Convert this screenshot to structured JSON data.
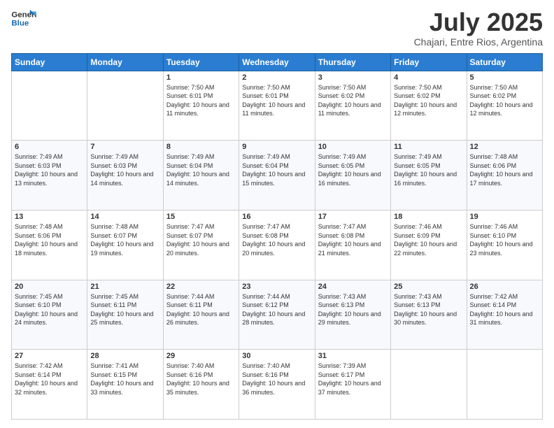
{
  "header": {
    "logo_line1": "General",
    "logo_line2": "Blue",
    "title": "July 2025",
    "subtitle": "Chajari, Entre Rios, Argentina"
  },
  "weekdays": [
    "Sunday",
    "Monday",
    "Tuesday",
    "Wednesday",
    "Thursday",
    "Friday",
    "Saturday"
  ],
  "weeks": [
    [
      {
        "day": null,
        "info": null
      },
      {
        "day": null,
        "info": null
      },
      {
        "day": "1",
        "info": "Sunrise: 7:50 AM\nSunset: 6:01 PM\nDaylight: 10 hours and 11 minutes."
      },
      {
        "day": "2",
        "info": "Sunrise: 7:50 AM\nSunset: 6:01 PM\nDaylight: 10 hours and 11 minutes."
      },
      {
        "day": "3",
        "info": "Sunrise: 7:50 AM\nSunset: 6:02 PM\nDaylight: 10 hours and 11 minutes."
      },
      {
        "day": "4",
        "info": "Sunrise: 7:50 AM\nSunset: 6:02 PM\nDaylight: 10 hours and 12 minutes."
      },
      {
        "day": "5",
        "info": "Sunrise: 7:50 AM\nSunset: 6:02 PM\nDaylight: 10 hours and 12 minutes."
      }
    ],
    [
      {
        "day": "6",
        "info": "Sunrise: 7:49 AM\nSunset: 6:03 PM\nDaylight: 10 hours and 13 minutes."
      },
      {
        "day": "7",
        "info": "Sunrise: 7:49 AM\nSunset: 6:03 PM\nDaylight: 10 hours and 14 minutes."
      },
      {
        "day": "8",
        "info": "Sunrise: 7:49 AM\nSunset: 6:04 PM\nDaylight: 10 hours and 14 minutes."
      },
      {
        "day": "9",
        "info": "Sunrise: 7:49 AM\nSunset: 6:04 PM\nDaylight: 10 hours and 15 minutes."
      },
      {
        "day": "10",
        "info": "Sunrise: 7:49 AM\nSunset: 6:05 PM\nDaylight: 10 hours and 16 minutes."
      },
      {
        "day": "11",
        "info": "Sunrise: 7:49 AM\nSunset: 6:05 PM\nDaylight: 10 hours and 16 minutes."
      },
      {
        "day": "12",
        "info": "Sunrise: 7:48 AM\nSunset: 6:06 PM\nDaylight: 10 hours and 17 minutes."
      }
    ],
    [
      {
        "day": "13",
        "info": "Sunrise: 7:48 AM\nSunset: 6:06 PM\nDaylight: 10 hours and 18 minutes."
      },
      {
        "day": "14",
        "info": "Sunrise: 7:48 AM\nSunset: 6:07 PM\nDaylight: 10 hours and 19 minutes."
      },
      {
        "day": "15",
        "info": "Sunrise: 7:47 AM\nSunset: 6:07 PM\nDaylight: 10 hours and 20 minutes."
      },
      {
        "day": "16",
        "info": "Sunrise: 7:47 AM\nSunset: 6:08 PM\nDaylight: 10 hours and 20 minutes."
      },
      {
        "day": "17",
        "info": "Sunrise: 7:47 AM\nSunset: 6:08 PM\nDaylight: 10 hours and 21 minutes."
      },
      {
        "day": "18",
        "info": "Sunrise: 7:46 AM\nSunset: 6:09 PM\nDaylight: 10 hours and 22 minutes."
      },
      {
        "day": "19",
        "info": "Sunrise: 7:46 AM\nSunset: 6:10 PM\nDaylight: 10 hours and 23 minutes."
      }
    ],
    [
      {
        "day": "20",
        "info": "Sunrise: 7:45 AM\nSunset: 6:10 PM\nDaylight: 10 hours and 24 minutes."
      },
      {
        "day": "21",
        "info": "Sunrise: 7:45 AM\nSunset: 6:11 PM\nDaylight: 10 hours and 25 minutes."
      },
      {
        "day": "22",
        "info": "Sunrise: 7:44 AM\nSunset: 6:11 PM\nDaylight: 10 hours and 26 minutes."
      },
      {
        "day": "23",
        "info": "Sunrise: 7:44 AM\nSunset: 6:12 PM\nDaylight: 10 hours and 28 minutes."
      },
      {
        "day": "24",
        "info": "Sunrise: 7:43 AM\nSunset: 6:13 PM\nDaylight: 10 hours and 29 minutes."
      },
      {
        "day": "25",
        "info": "Sunrise: 7:43 AM\nSunset: 6:13 PM\nDaylight: 10 hours and 30 minutes."
      },
      {
        "day": "26",
        "info": "Sunrise: 7:42 AM\nSunset: 6:14 PM\nDaylight: 10 hours and 31 minutes."
      }
    ],
    [
      {
        "day": "27",
        "info": "Sunrise: 7:42 AM\nSunset: 6:14 PM\nDaylight: 10 hours and 32 minutes."
      },
      {
        "day": "28",
        "info": "Sunrise: 7:41 AM\nSunset: 6:15 PM\nDaylight: 10 hours and 33 minutes."
      },
      {
        "day": "29",
        "info": "Sunrise: 7:40 AM\nSunset: 6:16 PM\nDaylight: 10 hours and 35 minutes."
      },
      {
        "day": "30",
        "info": "Sunrise: 7:40 AM\nSunset: 6:16 PM\nDaylight: 10 hours and 36 minutes."
      },
      {
        "day": "31",
        "info": "Sunrise: 7:39 AM\nSunset: 6:17 PM\nDaylight: 10 hours and 37 minutes."
      },
      {
        "day": null,
        "info": null
      },
      {
        "day": null,
        "info": null
      }
    ]
  ]
}
